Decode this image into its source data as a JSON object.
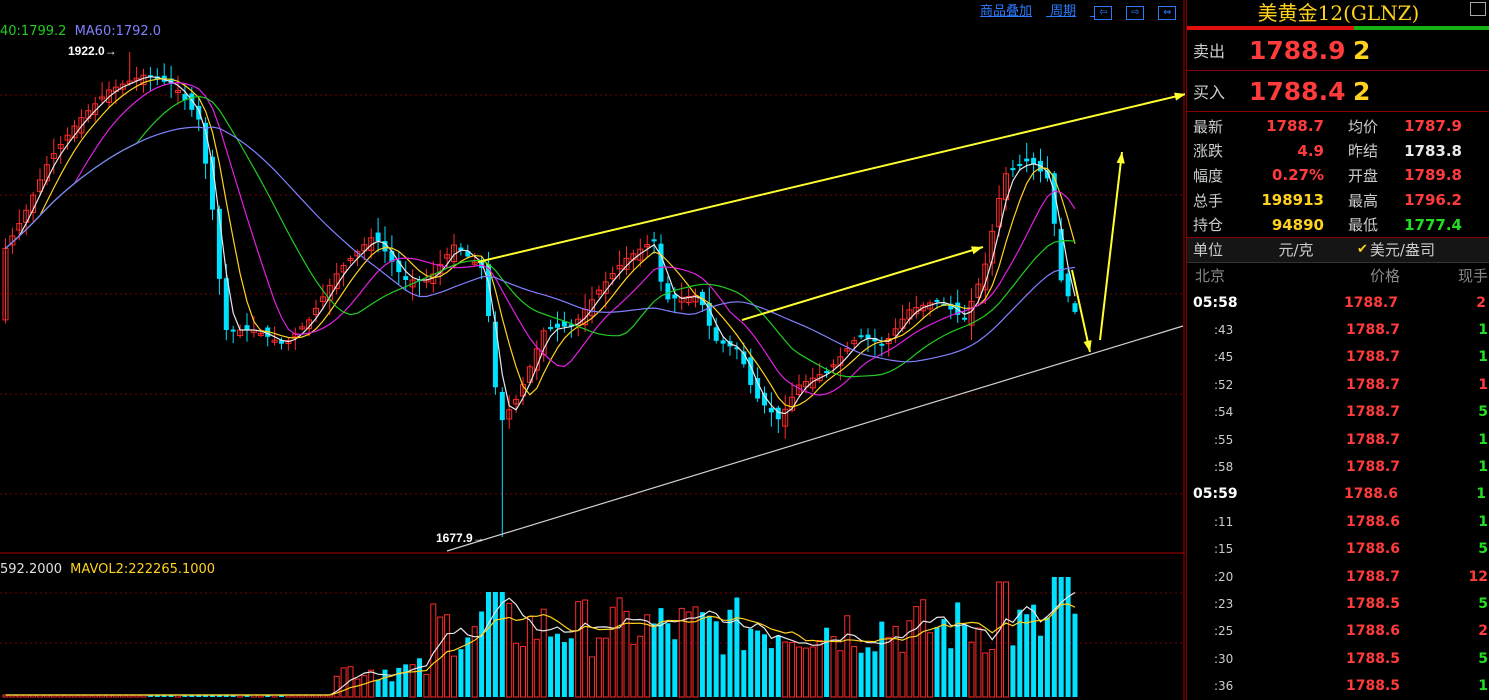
{
  "chart": {
    "ma_labels": [
      {
        "text": "40:1799.2",
        "color": "#22cc22"
      },
      {
        "text": "MA60:1792.0",
        "color": "#8080ff"
      }
    ],
    "high_marker": "1922.0",
    "low_marker": "1677.9",
    "vol_labels": [
      {
        "text": "592.2000",
        "color": "#e0e0e0"
      },
      {
        "text": "MAVOL2:222265.1000",
        "color": "#ffd21e"
      }
    ],
    "colors": {
      "up": "#ff2a2a",
      "down": "#00e0ff",
      "grid": "#7a0000",
      "arrow": "#ffff30",
      "trend": "#d0d0d0"
    }
  },
  "toolbar": {
    "overlay_link": "商品叠加",
    "period_link": "周期",
    "nav_icons": [
      "arrow-left-icon",
      "arrow-right-icon",
      "arrow-both-icon"
    ]
  },
  "panel": {
    "title": "美黄金12(GLNZ)",
    "sell": {
      "label": "卖出",
      "price": "1788.9",
      "volume": "2"
    },
    "buy": {
      "label": "买入",
      "price": "1788.4",
      "volume": "2"
    },
    "stats": [
      {
        "k": "最新",
        "v": "1788.7",
        "vc": "#ff3b3b",
        "k2": "均价",
        "v2": "1787.9",
        "v2c": "#ff3b3b"
      },
      {
        "k": "涨跌",
        "v": "4.9",
        "vc": "#ff3b3b",
        "k2": "昨结",
        "v2": "1783.8",
        "v2c": "#e8e8e8"
      },
      {
        "k": "幅度",
        "v": "0.27%",
        "vc": "#ff3b3b",
        "k2": "开盘",
        "v2": "1789.8",
        "v2c": "#ff3b3b"
      },
      {
        "k": "总手",
        "v": "198913",
        "vc": "#ffd21e",
        "k2": "最高",
        "v2": "1796.2",
        "v2c": "#ff3b3b"
      },
      {
        "k": "持仓",
        "v": "94890",
        "vc": "#ffd21e",
        "k2": "最低",
        "v2": "1777.4",
        "v2c": "#22dd22"
      }
    ],
    "unit": {
      "label": "单位",
      "value": "元/克",
      "check": "✔",
      "alt": "美元/盎司"
    },
    "tick_header": {
      "time": "北京",
      "price": "价格",
      "qty": "现手"
    },
    "ticks": [
      {
        "t": "05:58",
        "full": true,
        "p": "1788.7",
        "q": "2",
        "qc": "#ff3b3b"
      },
      {
        "t": ":43",
        "full": false,
        "p": "1788.7",
        "q": "1",
        "qc": "#22dd22"
      },
      {
        "t": ":45",
        "full": false,
        "p": "1788.7",
        "q": "1",
        "qc": "#22dd22"
      },
      {
        "t": ":52",
        "full": false,
        "p": "1788.7",
        "q": "1",
        "qc": "#ff3b3b"
      },
      {
        "t": ":54",
        "full": false,
        "p": "1788.7",
        "q": "5",
        "qc": "#22dd22"
      },
      {
        "t": ":55",
        "full": false,
        "p": "1788.7",
        "q": "1",
        "qc": "#22dd22"
      },
      {
        "t": ":58",
        "full": false,
        "p": "1788.7",
        "q": "1",
        "qc": "#22dd22"
      },
      {
        "t": "05:59",
        "full": true,
        "p": "1788.6",
        "q": "1",
        "qc": "#22dd22"
      },
      {
        "t": ":11",
        "full": false,
        "p": "1788.6",
        "q": "1",
        "qc": "#22dd22"
      },
      {
        "t": ":15",
        "full": false,
        "p": "1788.6",
        "q": "5",
        "qc": "#22dd22"
      },
      {
        "t": ":20",
        "full": false,
        "p": "1788.7",
        "q": "12",
        "qc": "#ff3b3b"
      },
      {
        "t": ":23",
        "full": false,
        "p": "1788.5",
        "q": "5",
        "qc": "#22dd22"
      },
      {
        "t": ":25",
        "full": false,
        "p": "1788.6",
        "q": "2",
        "qc": "#ff3b3b"
      },
      {
        "t": ":30",
        "full": false,
        "p": "1788.5",
        "q": "5",
        "qc": "#22dd22"
      },
      {
        "t": ":36",
        "full": false,
        "p": "1788.5",
        "q": "1",
        "qc": "#22dd22"
      }
    ]
  }
}
